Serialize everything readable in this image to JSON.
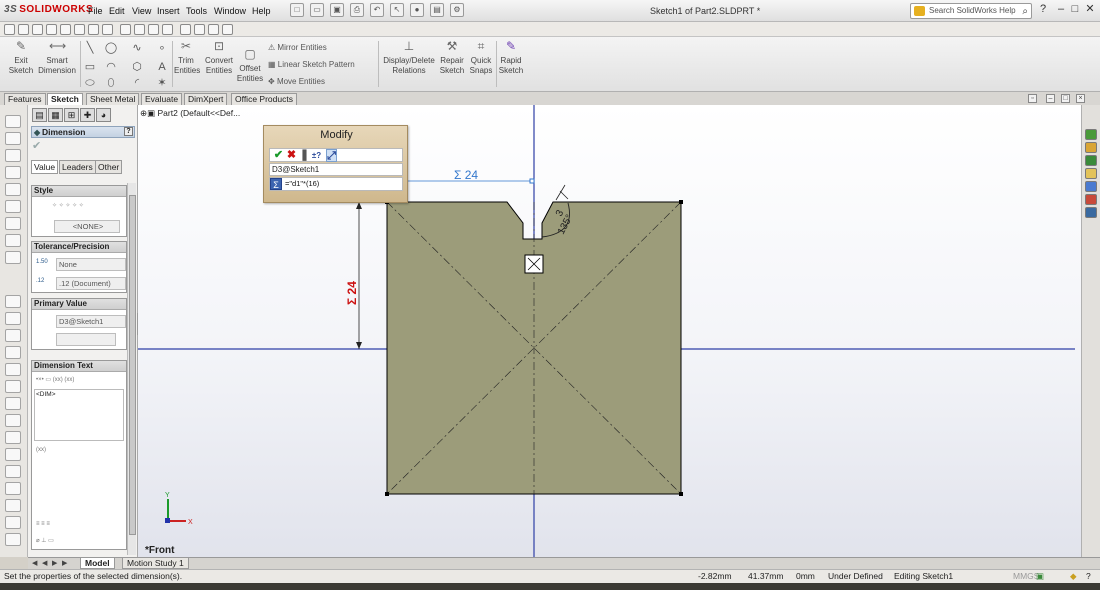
{
  "app": {
    "logo_text": "SOLIDWORKS",
    "window_title": "Sketch1 of Part2.SLDPRT *",
    "search_placeholder": "Search SolidWorks Help"
  },
  "menu": [
    "File",
    "Edit",
    "View",
    "Insert",
    "Tools",
    "Window",
    "Help"
  ],
  "ribbon": {
    "exit_sketch": [
      "Exit",
      "Sketch"
    ],
    "smart_dimension": [
      "Smart",
      "Dimension"
    ],
    "trim_entities": [
      "Trim",
      "Entities"
    ],
    "convert_entities": [
      "Convert",
      "Entities"
    ],
    "offset_entities": [
      "Offset",
      "Entities"
    ],
    "mirror_entities": "Mirror Entities",
    "linear_sketch_pattern": "Linear Sketch Pattern",
    "move_entities": "Move Entities",
    "display_delete_relations": [
      "Display/Delete",
      "Relations"
    ],
    "repair_sketch": [
      "Repair",
      "Sketch"
    ],
    "quick_snaps": [
      "Quick",
      "Snaps"
    ],
    "rapid_sketch": [
      "Rapid",
      "Sketch"
    ]
  },
  "tabs": [
    "Features",
    "Sketch",
    "Sheet Metal",
    "Evaluate",
    "DimXpert",
    "Office Products"
  ],
  "property_manager": {
    "title": "Dimension",
    "subtabs": [
      "Value",
      "Leaders",
      "Other"
    ],
    "style_header": "Style",
    "style_value": "<NONE>",
    "tolerance_header": "Tolerance/Precision",
    "tolerance_type": "None",
    "precision": ".12 (Document)",
    "primary_header": "Primary Value",
    "primary_name": "D3@Sketch1",
    "dimtext_header": "Dimension Text",
    "dimtext_value": "<DIM>"
  },
  "tree": {
    "item": "Part2  (Default<<Def..."
  },
  "modify": {
    "title": "Modify",
    "dimension_name": "D3@Sketch1",
    "equation_input": "=\"d1\"*(16)"
  },
  "drawing": {
    "horizontal_dimension": "Σ 24",
    "vertical_dimension": "Σ 24",
    "chamfer_length": "3",
    "chamfer_angle": "135°",
    "sketch_color": "#9c9c7a",
    "axis_color": "#2f3fa6",
    "dimension_color": "#3377cc",
    "vertical_dimension_color": "#cc1111"
  },
  "view": {
    "orientation_label": "*Front"
  },
  "bottom_tabs": [
    "Model",
    "Motion Study 1"
  ],
  "status": {
    "hint": "Set the properties of the selected dimension(s).",
    "x": "-2.82mm",
    "y": "41.37mm",
    "z": "0mm",
    "definition": "Under Defined",
    "mode": "Editing Sketch1",
    "units": "MMGS"
  }
}
